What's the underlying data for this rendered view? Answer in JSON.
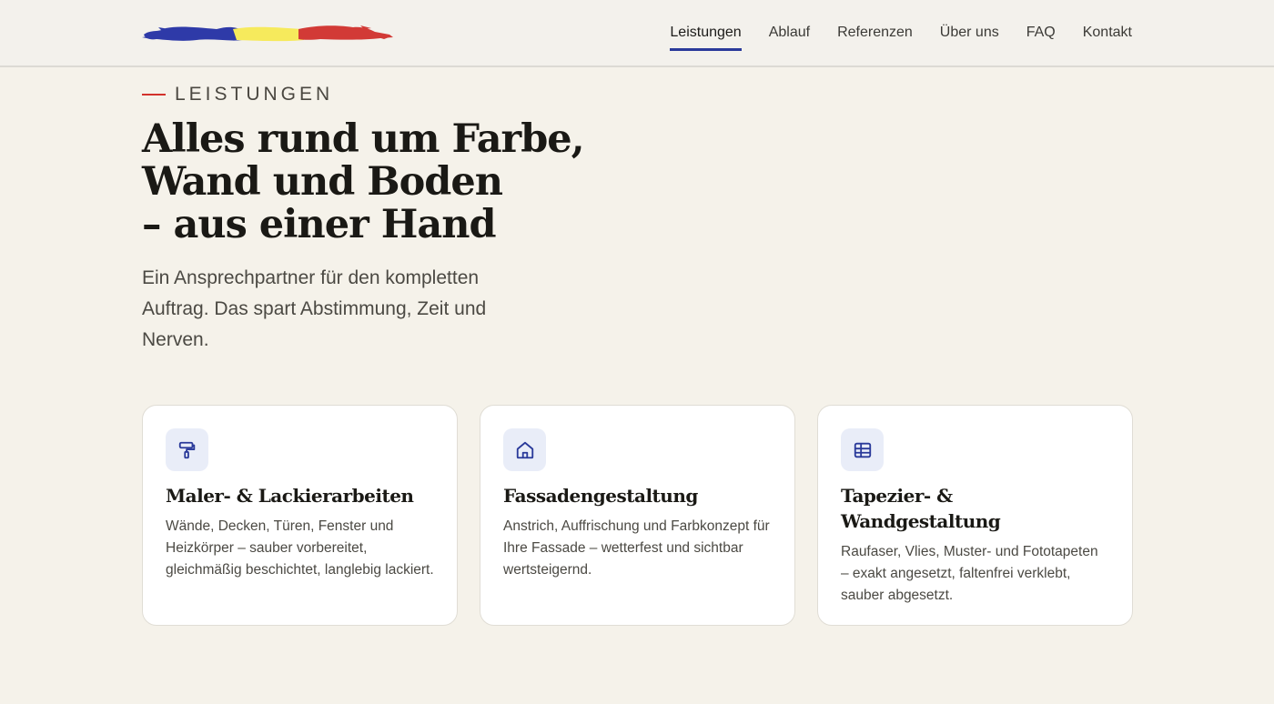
{
  "nav": {
    "items": [
      {
        "label": "Leistungen"
      },
      {
        "label": "Ablauf"
      },
      {
        "label": "Referenzen"
      },
      {
        "label": "Über uns"
      },
      {
        "label": "FAQ"
      },
      {
        "label": "Kontakt"
      }
    ],
    "active": "Leistungen"
  },
  "section": {
    "eyebrow": "LEISTUNGEN",
    "title_line1": "Alles rund um Farbe,",
    "title_line2": "Wand und Boden",
    "title_line3": "– aus einer Hand",
    "lead": "Ein Ansprechpartner für den kompletten Auftrag. Das spart Abstimmung, Zeit und Nerven."
  },
  "cards": [
    {
      "icon": "paint-roller-icon",
      "title": "Maler- & Lackierarbeiten",
      "text": "Wände, Decken, Türen, Fenster und Heizkörper – sauber vorbereitet, gleichmäßig beschichtet, langlebig lackiert."
    },
    {
      "icon": "house-icon",
      "title": "Fassadengestaltung",
      "text": "Anstrich, Auffrischung und Farbkonzept für Ihre Fassade – wetterfest und sichtbar wertsteigernd."
    },
    {
      "icon": "wallpaper-grid-icon",
      "title": "Tapezier- & Wandgestaltung",
      "text": "Raufaser, Vlies, Muster- und Fototapeten – exakt angesetzt, faltenfrei verklebt, sauber abgesetzt."
    }
  ],
  "colors": {
    "accent": "#2a3a9a",
    "brand_blue": "#2e3aa8",
    "brand_yellow": "#f6ea5c",
    "brand_red": "#d23a36",
    "background": "#f5f2ea"
  }
}
